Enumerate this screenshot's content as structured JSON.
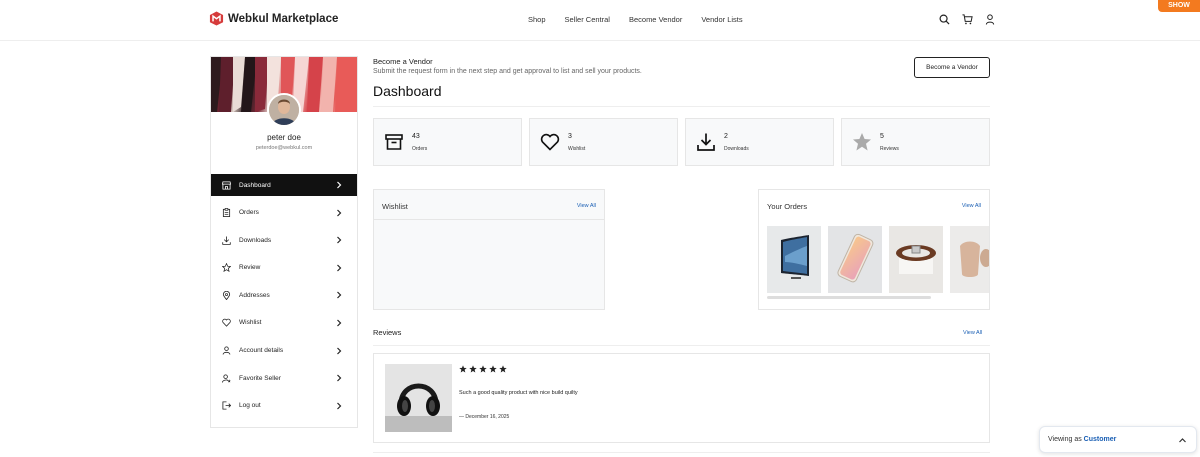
{
  "header": {
    "brand": "Webkul Marketplace",
    "nav": [
      "Shop",
      "Seller Central",
      "Become Vendor",
      "Vendor Lists"
    ],
    "show_label": "SHOW"
  },
  "sidebar": {
    "name": "peter doe",
    "email": "peterdoe@webkul.com",
    "items": [
      {
        "label": "Dashboard",
        "icon": "store-icon",
        "active": true
      },
      {
        "label": "Orders",
        "icon": "clipboard-icon"
      },
      {
        "label": "Downloads",
        "icon": "download-icon"
      },
      {
        "label": "Review",
        "icon": "star-icon"
      },
      {
        "label": "Addresses",
        "icon": "location-icon"
      },
      {
        "label": "Wishlist",
        "icon": "heart-icon"
      },
      {
        "label": "Account details",
        "icon": "user-icon"
      },
      {
        "label": "Favorite Seller",
        "icon": "user-star-icon"
      },
      {
        "label": "Log out",
        "icon": "logout-icon"
      }
    ]
  },
  "become_vendor": {
    "title": "Become a Vendor",
    "subtitle": "Submit the request form in the next step and get approval to list and sell your products.",
    "button": "Become a Vendor"
  },
  "dashboard": {
    "title": "Dashboard",
    "stats": [
      {
        "value": "43",
        "label": "Orders",
        "icon": "archive-icon"
      },
      {
        "value": "3",
        "label": "Wishlist",
        "icon": "heart-icon"
      },
      {
        "value": "2",
        "label": "Downloads",
        "icon": "download-icon"
      },
      {
        "value": "5",
        "label": "Reviews",
        "icon": "star-icon"
      }
    ]
  },
  "wishlist": {
    "title": "Wishlist",
    "link": "View All"
  },
  "orders": {
    "title": "Your Orders",
    "link": "View All",
    "products": [
      "tv",
      "phone",
      "belt",
      "earbuds"
    ]
  },
  "reviews": {
    "title": "Reviews",
    "link": "View All",
    "items": [
      {
        "rating": 5,
        "text": "Such a good quality product with nice build quilty",
        "date": "— December 16, 2025"
      }
    ]
  },
  "viewing": {
    "prefix": "Viewing as ",
    "role": "Customer"
  },
  "colors": {
    "accent": "#f37a1f",
    "link": "#1a5fb4",
    "active_bg": "#111111"
  }
}
